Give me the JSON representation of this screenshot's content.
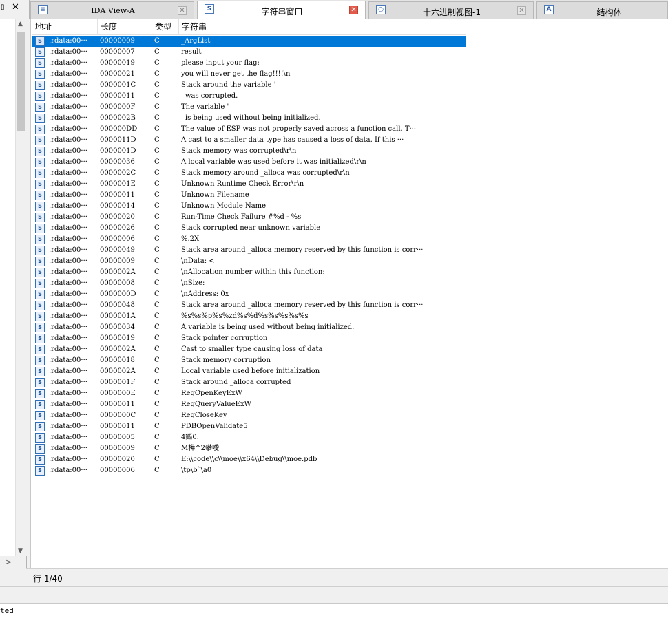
{
  "left_tab": {
    "pin_icon": "pin-icon",
    "close_glyph": "✕"
  },
  "tabs": [
    {
      "label": "IDA View-A",
      "icon": "ida-view-icon",
      "close": "✕"
    },
    {
      "label": "字符串窗口",
      "icon": "strings-icon",
      "close": "✕"
    },
    {
      "label": "十六进制视图-1",
      "icon": "hex-view-icon",
      "close": "✕"
    },
    {
      "label": "结构体",
      "icon": "struct-icon"
    }
  ],
  "columns": {
    "address": "地址",
    "length": "长度",
    "type": "类型",
    "string": "字符串"
  },
  "rows": [
    {
      "addr": ".rdata:00···",
      "len": "00000009",
      "type": "C",
      "str": "_ArgList"
    },
    {
      "addr": ".rdata:00···",
      "len": "00000007",
      "type": "C",
      "str": "result"
    },
    {
      "addr": ".rdata:00···",
      "len": "00000019",
      "type": "C",
      "str": "please input your flag:"
    },
    {
      "addr": ".rdata:00···",
      "len": "00000021",
      "type": "C",
      "str": "you will never get the flag!!!!\\n"
    },
    {
      "addr": ".rdata:00···",
      "len": "0000001C",
      "type": "C",
      "str": "Stack around the variable '"
    },
    {
      "addr": ".rdata:00···",
      "len": "00000011",
      "type": "C",
      "str": "' was corrupted."
    },
    {
      "addr": ".rdata:00···",
      "len": "0000000F",
      "type": "C",
      "str": "The variable '"
    },
    {
      "addr": ".rdata:00···",
      "len": "0000002B",
      "type": "C",
      "str": "' is being used without being initialized."
    },
    {
      "addr": ".rdata:00···",
      "len": "000000DD",
      "type": "C",
      "str": "The value of ESP was not properly saved across a function call.  T···"
    },
    {
      "addr": ".rdata:00···",
      "len": "0000011D",
      "type": "C",
      "str": "A cast to a smaller data type has caused a loss of data.  If this ···"
    },
    {
      "addr": ".rdata:00···",
      "len": "0000001D",
      "type": "C",
      "str": "Stack memory was corrupted\\r\\n"
    },
    {
      "addr": ".rdata:00···",
      "len": "00000036",
      "type": "C",
      "str": "A local variable was used before it was initialized\\r\\n"
    },
    {
      "addr": ".rdata:00···",
      "len": "0000002C",
      "type": "C",
      "str": "Stack memory around _alloca was corrupted\\r\\n"
    },
    {
      "addr": ".rdata:00···",
      "len": "0000001E",
      "type": "C",
      "str": "Unknown Runtime Check Error\\r\\n"
    },
    {
      "addr": ".rdata:00···",
      "len": "00000011",
      "type": "C",
      "str": "Unknown Filename"
    },
    {
      "addr": ".rdata:00···",
      "len": "00000014",
      "type": "C",
      "str": "Unknown Module Name"
    },
    {
      "addr": ".rdata:00···",
      "len": "00000020",
      "type": "C",
      "str": "Run-Time Check Failure #%d - %s"
    },
    {
      "addr": ".rdata:00···",
      "len": "00000026",
      "type": "C",
      "str": "Stack corrupted near unknown variable"
    },
    {
      "addr": ".rdata:00···",
      "len": "00000006",
      "type": "C",
      "str": "%.2X"
    },
    {
      "addr": ".rdata:00···",
      "len": "00000049",
      "type": "C",
      "str": "Stack area around _alloca memory reserved by this function is corr···"
    },
    {
      "addr": ".rdata:00···",
      "len": "00000009",
      "type": "C",
      "str": "\\nData: <"
    },
    {
      "addr": ".rdata:00···",
      "len": "0000002A",
      "type": "C",
      "str": "\\nAllocation number within this function:"
    },
    {
      "addr": ".rdata:00···",
      "len": "00000008",
      "type": "C",
      "str": "\\nSize:"
    },
    {
      "addr": ".rdata:00···",
      "len": "0000000D",
      "type": "C",
      "str": "\\nAddress: 0x"
    },
    {
      "addr": ".rdata:00···",
      "len": "00000048",
      "type": "C",
      "str": "Stack area around _alloca memory reserved by this function is corr···"
    },
    {
      "addr": ".rdata:00···",
      "len": "0000001A",
      "type": "C",
      "str": "%s%s%p%s%zd%s%d%s%s%s%s%s"
    },
    {
      "addr": ".rdata:00···",
      "len": "00000034",
      "type": "C",
      "str": "A variable is being used without being initialized."
    },
    {
      "addr": ".rdata:00···",
      "len": "00000019",
      "type": "C",
      "str": "Stack pointer corruption"
    },
    {
      "addr": ".rdata:00···",
      "len": "0000002A",
      "type": "C",
      "str": "Cast to smaller type causing loss of data"
    },
    {
      "addr": ".rdata:00···",
      "len": "00000018",
      "type": "C",
      "str": "Stack memory corruption"
    },
    {
      "addr": ".rdata:00···",
      "len": "0000002A",
      "type": "C",
      "str": "Local variable used before initialization"
    },
    {
      "addr": ".rdata:00···",
      "len": "0000001F",
      "type": "C",
      "str": "Stack around _alloca corrupted"
    },
    {
      "addr": ".rdata:00···",
      "len": "0000000E",
      "type": "C",
      "str": "RegOpenKeyExW"
    },
    {
      "addr": ".rdata:00···",
      "len": "00000011",
      "type": "C",
      "str": "RegQueryValueExW"
    },
    {
      "addr": ".rdata:00···",
      "len": "0000000C",
      "type": "C",
      "str": "RegCloseKey"
    },
    {
      "addr": ".rdata:00···",
      "len": "00000011",
      "type": "C",
      "str": "PDBOpenValidate5"
    },
    {
      "addr": ".rdata:00···",
      "len": "00000005",
      "type": "C",
      "str": "4鏂0."
    },
    {
      "addr": ".rdata:00···",
      "len": "00000009",
      "type": "C",
      "str": "M樺^2攀噯"
    },
    {
      "addr": ".rdata:00···",
      "len": "00000020",
      "type": "C",
      "str": "E:\\\\code\\\\c\\\\moe\\\\x64\\\\Debug\\\\moe.pdb"
    },
    {
      "addr": ".rdata:00···",
      "len": "00000006",
      "type": "C",
      "str": "\\tp\\b`\\a0"
    }
  ],
  "selected_row": 0,
  "status": {
    "text": "行 1/40"
  },
  "output": {
    "text": "ted"
  },
  "colors": {
    "selection": "#0078d7",
    "active_close": "#e05b4b"
  }
}
